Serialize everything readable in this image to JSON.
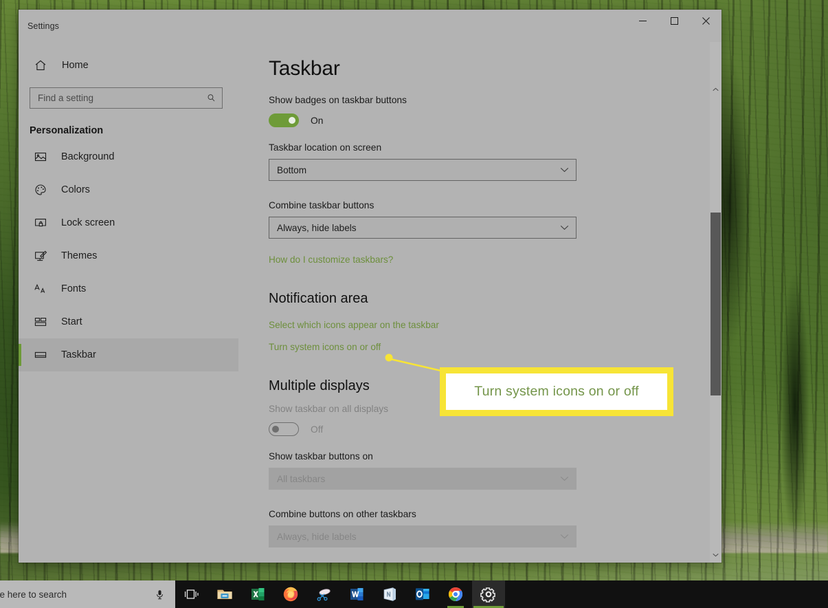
{
  "window": {
    "app_title": "Settings",
    "controls": {
      "minimize": "minimize-button",
      "maximize": "maximize-button",
      "close": "close-button"
    }
  },
  "sidebar": {
    "home_label": "Home",
    "search": {
      "placeholder": "Find a setting",
      "value": ""
    },
    "section_title": "Personalization",
    "items": [
      {
        "label": "Background",
        "icon": "image-icon",
        "selected": false
      },
      {
        "label": "Colors",
        "icon": "palette-icon",
        "selected": false
      },
      {
        "label": "Lock screen",
        "icon": "lock-screen-icon",
        "selected": false
      },
      {
        "label": "Themes",
        "icon": "brush-icon",
        "selected": false
      },
      {
        "label": "Fonts",
        "icon": "fonts-icon",
        "selected": false
      },
      {
        "label": "Start",
        "icon": "start-tiles-icon",
        "selected": false
      },
      {
        "label": "Taskbar",
        "icon": "taskbar-icon",
        "selected": true
      }
    ]
  },
  "main": {
    "page_title": "Taskbar",
    "badges": {
      "label": "Show badges on taskbar buttons",
      "state": "On"
    },
    "location": {
      "label": "Taskbar location on screen",
      "value": "Bottom"
    },
    "combine": {
      "label": "Combine taskbar buttons",
      "value": "Always, hide labels"
    },
    "help_link": "How do I customize taskbars?",
    "notification_area": {
      "heading": "Notification area",
      "link_select_icons": "Select which icons appear on the taskbar",
      "link_system_icons": "Turn system icons on or off"
    },
    "multiple_displays": {
      "heading": "Multiple displays",
      "show_all": {
        "label": "Show taskbar on all displays",
        "state": "Off"
      },
      "buttons_on": {
        "label": "Show taskbar buttons on",
        "value": "All taskbars"
      },
      "combine_other": {
        "label": "Combine buttons on other taskbars",
        "value": "Always, hide labels"
      }
    }
  },
  "annotation": {
    "callout_text": "Turn system icons on or off",
    "box_color": "#f7e436",
    "text_color": "#74954a"
  },
  "taskbar": {
    "search_text": "pe here to search",
    "mic_icon": "microphone-icon",
    "taskview_icon": "task-view-icon",
    "apps": [
      {
        "name": "file-explorer",
        "label": "File Explorer"
      },
      {
        "name": "excel",
        "label": "Excel"
      },
      {
        "name": "firefox",
        "label": "Firefox"
      },
      {
        "name": "snipping-tool",
        "label": "Snip & Sketch"
      },
      {
        "name": "word",
        "label": "Word"
      },
      {
        "name": "onenote",
        "label": "OneNote"
      },
      {
        "name": "outlook",
        "label": "Outlook"
      },
      {
        "name": "chrome",
        "label": "Google Chrome"
      },
      {
        "name": "settings",
        "label": "Settings"
      }
    ]
  },
  "theme": {
    "accent": "#6e9b38",
    "link": "#6d8f3c",
    "window_bg": "#b3b3b3"
  }
}
